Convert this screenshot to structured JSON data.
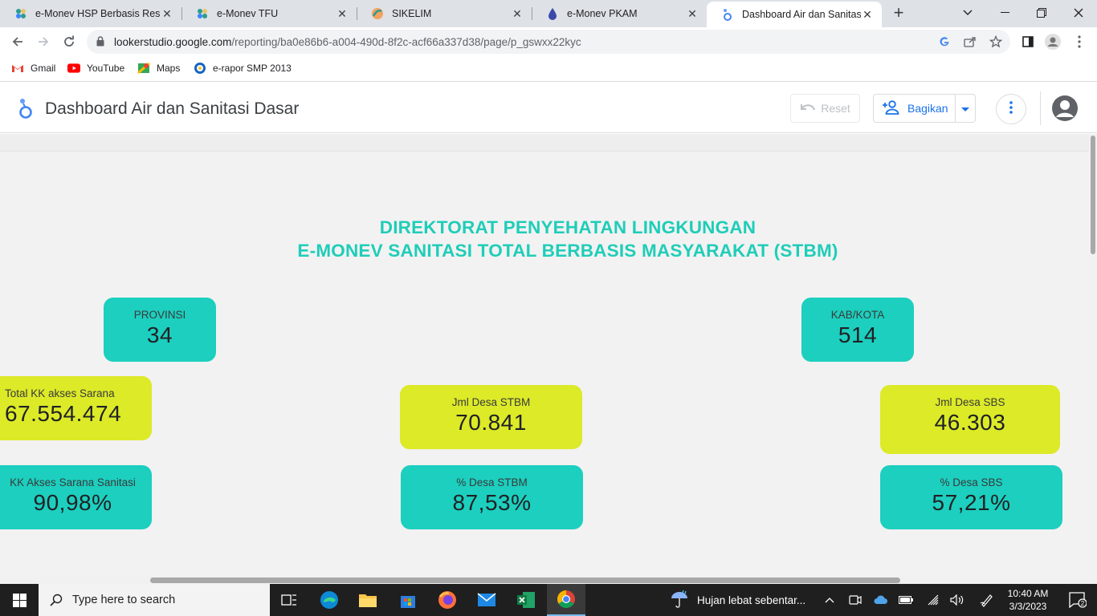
{
  "browser": {
    "tabs": [
      {
        "title": "e-Monev HSP Berbasis Resiko",
        "icon": "kemenkes-icon"
      },
      {
        "title": "e-Monev TFU",
        "icon": "kemenkes-icon"
      },
      {
        "title": "SIKELIM",
        "icon": "sikelim-icon"
      },
      {
        "title": "e-Monev PKAM",
        "icon": "water-drop-icon"
      },
      {
        "title": "Dashboard Air dan Sanitasi D",
        "icon": "looker-studio-icon",
        "active": true
      }
    ],
    "new_tab": "+",
    "url_host": "lookerstudio.google.com",
    "url_path": "/reporting/ba0e86b6-a004-490d-8f2c-acf66a337d38/page/p_gswxx22kyc",
    "bookmarks": [
      {
        "label": "Gmail",
        "icon": "gmail-icon"
      },
      {
        "label": "YouTube",
        "icon": "youtube-icon"
      },
      {
        "label": "Maps",
        "icon": "maps-icon"
      },
      {
        "label": "e-rapor SMP 2013",
        "icon": "erapor-icon"
      }
    ]
  },
  "report": {
    "title": "Dashboard Air dan Sanitasi Dasar",
    "reset_label": "Reset",
    "share_label": "Bagikan",
    "heading_line1": "DIREKTORAT PENYEHATAN LINGKUNGAN",
    "heading_line2": "E-MONEV SANITASI TOTAL BERBASIS MASYARAKAT (STBM)",
    "colors": {
      "teal": "#1ccfbf",
      "lime": "#dcea28",
      "heading": "#1fcdb8"
    },
    "cards": {
      "provinsi": {
        "label": "PROVINSI",
        "value": "34"
      },
      "kabkota": {
        "label": "KAB/KOTA",
        "value": "514"
      },
      "total_kk": {
        "label": "Total KK akses Sarana",
        "value": "67.554.474"
      },
      "jml_desa_stbm": {
        "label": "Jml Desa STBM",
        "value": "70.841"
      },
      "jml_desa_sbs": {
        "label": "Jml Desa SBS",
        "value": "46.303"
      },
      "kk_akses": {
        "label": "KK Akses Sarana Sanitasi",
        "value": "90,98%"
      },
      "pct_desa_stbm": {
        "label": "% Desa STBM",
        "value": "87,53%"
      },
      "pct_desa_sbs": {
        "label": "% Desa SBS",
        "value": "57,21%"
      }
    }
  },
  "taskbar": {
    "search_placeholder": "Type here to search",
    "weather": "Hujan lebat sebentar...",
    "time": "10:40 AM",
    "date": "3/3/2023",
    "notifications": "2"
  }
}
